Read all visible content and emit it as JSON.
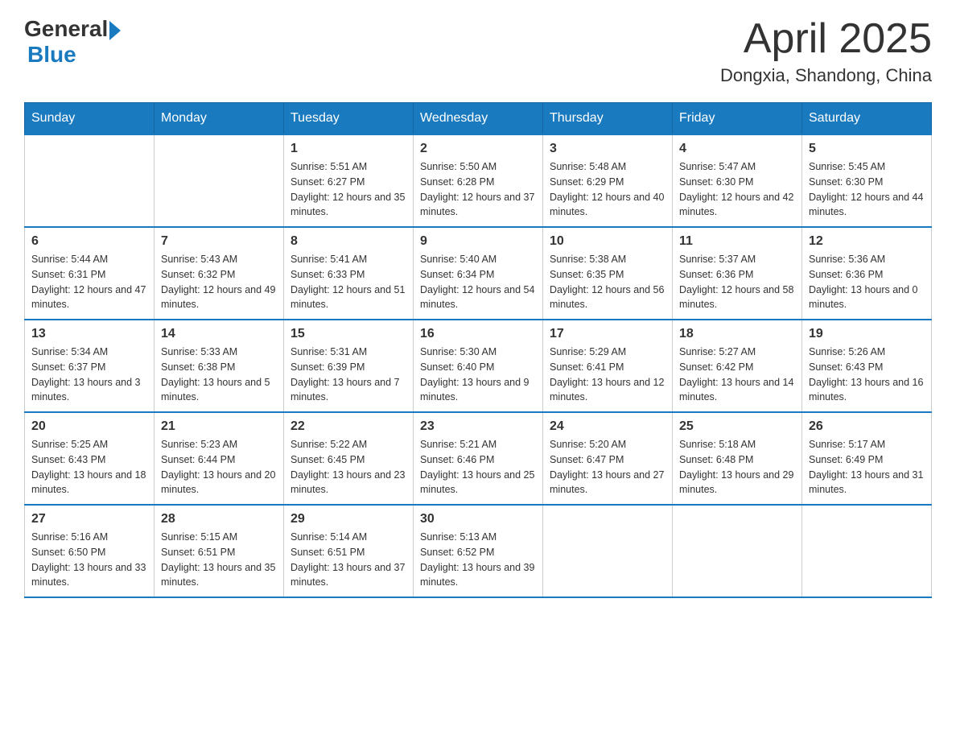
{
  "header": {
    "logo_general": "General",
    "logo_blue": "Blue",
    "month_title": "April 2025",
    "location": "Dongxia, Shandong, China"
  },
  "weekdays": [
    "Sunday",
    "Monday",
    "Tuesday",
    "Wednesday",
    "Thursday",
    "Friday",
    "Saturday"
  ],
  "weeks": [
    [
      {
        "day": "",
        "sunrise": "",
        "sunset": "",
        "daylight": ""
      },
      {
        "day": "",
        "sunrise": "",
        "sunset": "",
        "daylight": ""
      },
      {
        "day": "1",
        "sunrise": "Sunrise: 5:51 AM",
        "sunset": "Sunset: 6:27 PM",
        "daylight": "Daylight: 12 hours and 35 minutes."
      },
      {
        "day": "2",
        "sunrise": "Sunrise: 5:50 AM",
        "sunset": "Sunset: 6:28 PM",
        "daylight": "Daylight: 12 hours and 37 minutes."
      },
      {
        "day": "3",
        "sunrise": "Sunrise: 5:48 AM",
        "sunset": "Sunset: 6:29 PM",
        "daylight": "Daylight: 12 hours and 40 minutes."
      },
      {
        "day": "4",
        "sunrise": "Sunrise: 5:47 AM",
        "sunset": "Sunset: 6:30 PM",
        "daylight": "Daylight: 12 hours and 42 minutes."
      },
      {
        "day": "5",
        "sunrise": "Sunrise: 5:45 AM",
        "sunset": "Sunset: 6:30 PM",
        "daylight": "Daylight: 12 hours and 44 minutes."
      }
    ],
    [
      {
        "day": "6",
        "sunrise": "Sunrise: 5:44 AM",
        "sunset": "Sunset: 6:31 PM",
        "daylight": "Daylight: 12 hours and 47 minutes."
      },
      {
        "day": "7",
        "sunrise": "Sunrise: 5:43 AM",
        "sunset": "Sunset: 6:32 PM",
        "daylight": "Daylight: 12 hours and 49 minutes."
      },
      {
        "day": "8",
        "sunrise": "Sunrise: 5:41 AM",
        "sunset": "Sunset: 6:33 PM",
        "daylight": "Daylight: 12 hours and 51 minutes."
      },
      {
        "day": "9",
        "sunrise": "Sunrise: 5:40 AM",
        "sunset": "Sunset: 6:34 PM",
        "daylight": "Daylight: 12 hours and 54 minutes."
      },
      {
        "day": "10",
        "sunrise": "Sunrise: 5:38 AM",
        "sunset": "Sunset: 6:35 PM",
        "daylight": "Daylight: 12 hours and 56 minutes."
      },
      {
        "day": "11",
        "sunrise": "Sunrise: 5:37 AM",
        "sunset": "Sunset: 6:36 PM",
        "daylight": "Daylight: 12 hours and 58 minutes."
      },
      {
        "day": "12",
        "sunrise": "Sunrise: 5:36 AM",
        "sunset": "Sunset: 6:36 PM",
        "daylight": "Daylight: 13 hours and 0 minutes."
      }
    ],
    [
      {
        "day": "13",
        "sunrise": "Sunrise: 5:34 AM",
        "sunset": "Sunset: 6:37 PM",
        "daylight": "Daylight: 13 hours and 3 minutes."
      },
      {
        "day": "14",
        "sunrise": "Sunrise: 5:33 AM",
        "sunset": "Sunset: 6:38 PM",
        "daylight": "Daylight: 13 hours and 5 minutes."
      },
      {
        "day": "15",
        "sunrise": "Sunrise: 5:31 AM",
        "sunset": "Sunset: 6:39 PM",
        "daylight": "Daylight: 13 hours and 7 minutes."
      },
      {
        "day": "16",
        "sunrise": "Sunrise: 5:30 AM",
        "sunset": "Sunset: 6:40 PM",
        "daylight": "Daylight: 13 hours and 9 minutes."
      },
      {
        "day": "17",
        "sunrise": "Sunrise: 5:29 AM",
        "sunset": "Sunset: 6:41 PM",
        "daylight": "Daylight: 13 hours and 12 minutes."
      },
      {
        "day": "18",
        "sunrise": "Sunrise: 5:27 AM",
        "sunset": "Sunset: 6:42 PM",
        "daylight": "Daylight: 13 hours and 14 minutes."
      },
      {
        "day": "19",
        "sunrise": "Sunrise: 5:26 AM",
        "sunset": "Sunset: 6:43 PM",
        "daylight": "Daylight: 13 hours and 16 minutes."
      }
    ],
    [
      {
        "day": "20",
        "sunrise": "Sunrise: 5:25 AM",
        "sunset": "Sunset: 6:43 PM",
        "daylight": "Daylight: 13 hours and 18 minutes."
      },
      {
        "day": "21",
        "sunrise": "Sunrise: 5:23 AM",
        "sunset": "Sunset: 6:44 PM",
        "daylight": "Daylight: 13 hours and 20 minutes."
      },
      {
        "day": "22",
        "sunrise": "Sunrise: 5:22 AM",
        "sunset": "Sunset: 6:45 PM",
        "daylight": "Daylight: 13 hours and 23 minutes."
      },
      {
        "day": "23",
        "sunrise": "Sunrise: 5:21 AM",
        "sunset": "Sunset: 6:46 PM",
        "daylight": "Daylight: 13 hours and 25 minutes."
      },
      {
        "day": "24",
        "sunrise": "Sunrise: 5:20 AM",
        "sunset": "Sunset: 6:47 PM",
        "daylight": "Daylight: 13 hours and 27 minutes."
      },
      {
        "day": "25",
        "sunrise": "Sunrise: 5:18 AM",
        "sunset": "Sunset: 6:48 PM",
        "daylight": "Daylight: 13 hours and 29 minutes."
      },
      {
        "day": "26",
        "sunrise": "Sunrise: 5:17 AM",
        "sunset": "Sunset: 6:49 PM",
        "daylight": "Daylight: 13 hours and 31 minutes."
      }
    ],
    [
      {
        "day": "27",
        "sunrise": "Sunrise: 5:16 AM",
        "sunset": "Sunset: 6:50 PM",
        "daylight": "Daylight: 13 hours and 33 minutes."
      },
      {
        "day": "28",
        "sunrise": "Sunrise: 5:15 AM",
        "sunset": "Sunset: 6:51 PM",
        "daylight": "Daylight: 13 hours and 35 minutes."
      },
      {
        "day": "29",
        "sunrise": "Sunrise: 5:14 AM",
        "sunset": "Sunset: 6:51 PM",
        "daylight": "Daylight: 13 hours and 37 minutes."
      },
      {
        "day": "30",
        "sunrise": "Sunrise: 5:13 AM",
        "sunset": "Sunset: 6:52 PM",
        "daylight": "Daylight: 13 hours and 39 minutes."
      },
      {
        "day": "",
        "sunrise": "",
        "sunset": "",
        "daylight": ""
      },
      {
        "day": "",
        "sunrise": "",
        "sunset": "",
        "daylight": ""
      },
      {
        "day": "",
        "sunrise": "",
        "sunset": "",
        "daylight": ""
      }
    ]
  ]
}
